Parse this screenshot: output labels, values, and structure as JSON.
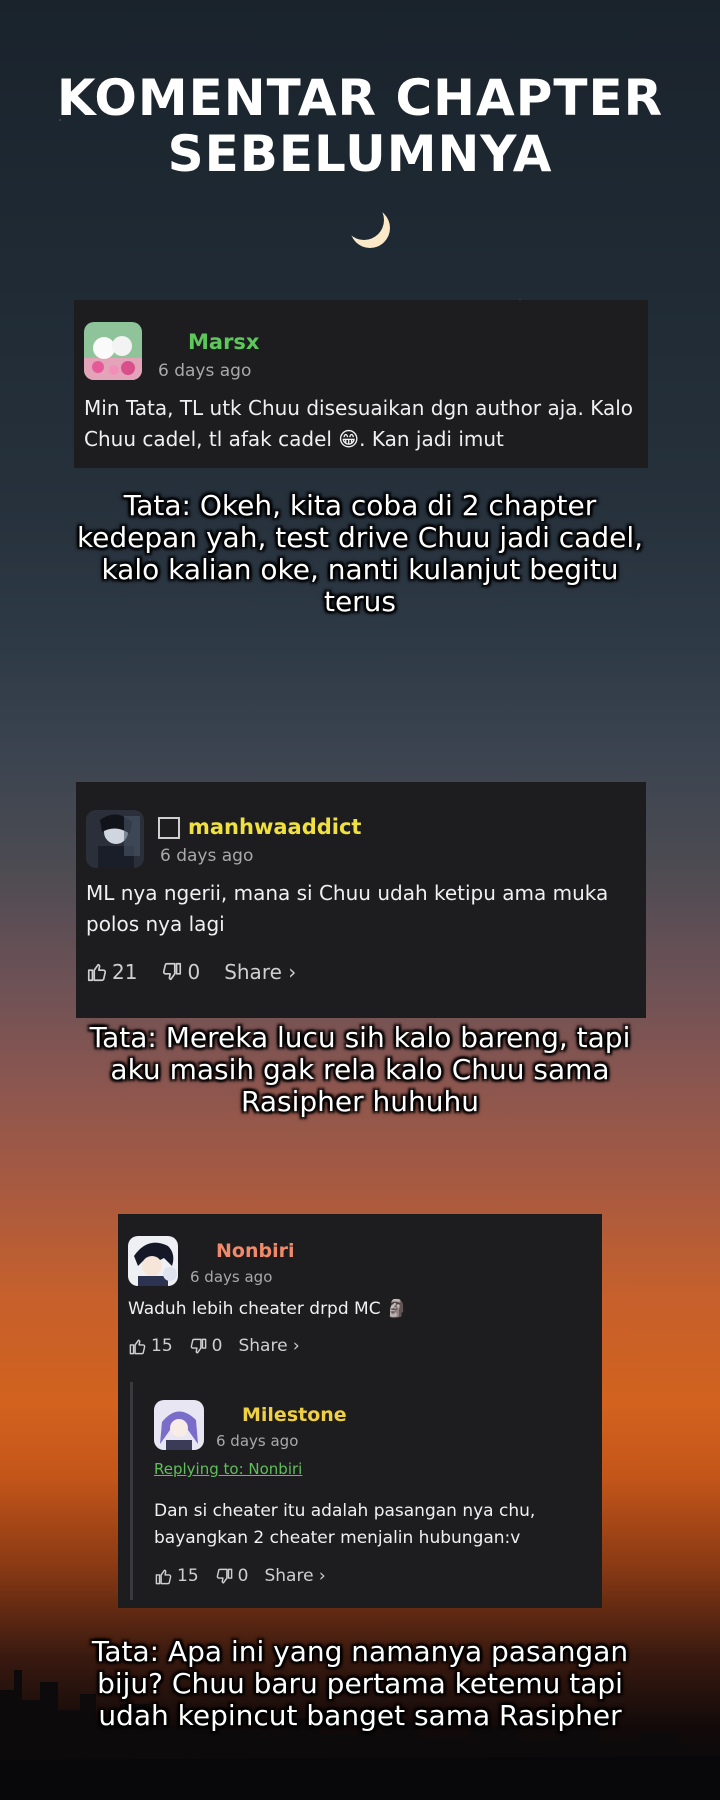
{
  "heading": {
    "line1": "KOMENTAR CHAPTER",
    "line2": "SEBELUMNYA"
  },
  "comment1": {
    "username": "Marsx",
    "username_color": "#5cc85a",
    "time": "6 days ago",
    "text_line1": "Min Tata, TL utk Chuu disesuaikan dgn author aja. Kalo",
    "text_line2_a": "Chuu cadel, tl afak cadel ",
    "text_line2_emoji": "😁",
    "text_line2_b": ". Kan jadi imut"
  },
  "caption1": {
    "line1": "Tata: Okeh, kita coba di 2 chapter",
    "line2": "kedepan yah, test drive Chuu jadi cadel,",
    "line3": "kalo kalian oke, nanti kulanjut begitu",
    "line4": "terus"
  },
  "comment2": {
    "username": "manhwaaddict",
    "username_color": "#f0e040",
    "time": "6 days ago",
    "text_line1": "ML nya ngerii, mana si Chuu udah ketipu ama muka",
    "text_line2": "polos nya lagi",
    "likes": "21",
    "dislikes": "0",
    "share": "Share ›"
  },
  "caption2": {
    "line1": "Tata: Mereka lucu sih kalo bareng, tapi",
    "line2": "aku masih gak rela kalo Chuu sama",
    "line3": "Rasipher huhuhu"
  },
  "comment3": {
    "username": "Nonbiri",
    "username_color": "#f08a6a",
    "time": "6 days ago",
    "text": "Waduh lebih cheater drpd MC 🗿",
    "likes": "15",
    "dislikes": "0",
    "share": "Share ›"
  },
  "reply": {
    "username": "Milestone",
    "username_color": "#f0d040",
    "time": "6 days ago",
    "replying_to": "Replying to: Nonbiri",
    "text_line1": "Dan si cheater itu adalah pasangan nya chu,",
    "text_line2": "bayangkan 2 cheater menjalin hubungan:v",
    "likes": "15",
    "dislikes": "0",
    "share": "Share ›"
  },
  "caption3": {
    "line1": "Tata: Apa ini yang namanya pasangan",
    "line2": "biju? Chuu baru pertama ketemu tapi",
    "line3": "udah kepincut banget sama Rasipher"
  }
}
